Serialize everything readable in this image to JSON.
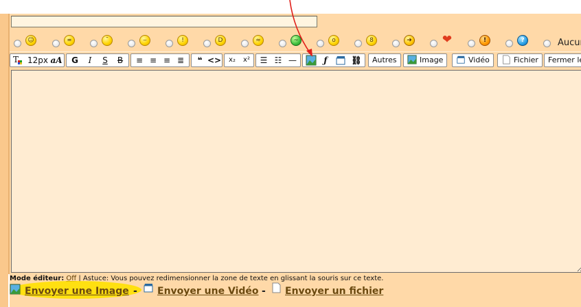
{
  "title_input": {
    "value": ""
  },
  "smileys": [
    {
      "icon": "happy-smiley-icon",
      "glyph": "☺"
    },
    {
      "icon": "smirk-smiley-icon",
      "glyph": "≖"
    },
    {
      "icon": "wink-smiley-icon",
      "glyph": "˘"
    },
    {
      "icon": "grin-smiley-icon",
      "glyph": "⌣"
    },
    {
      "icon": "surprised-smiley-icon",
      "glyph": "!"
    },
    {
      "icon": "big-grin-smiley-icon",
      "glyph": "D"
    },
    {
      "icon": "angry-smiley-icon",
      "glyph": "≈"
    },
    {
      "icon": "sick-smiley-icon",
      "glyph": "~"
    },
    {
      "icon": "shocked-smiley-icon",
      "glyph": "o"
    },
    {
      "icon": "cool-smiley-icon",
      "glyph": "8"
    },
    {
      "icon": "arrow-right-icon",
      "glyph": "➜"
    },
    {
      "icon": "heart-icon",
      "glyph": "❤"
    },
    {
      "icon": "warning-icon",
      "glyph": "!"
    },
    {
      "icon": "help-icon",
      "glyph": "?"
    }
  ],
  "smiley_none_label": "Aucun",
  "toolbar": {
    "font_size": "12px",
    "font_case": "aA",
    "bold": "G",
    "italic": "I",
    "underline": "S",
    "strike": "B",
    "quote": "❝",
    "code": "<>",
    "subscript": "x₂",
    "superscript": "x²",
    "other_label": "Autres",
    "image_label": "Image",
    "video_label": "Vidéo",
    "file_label": "Fichier",
    "close_label": "Fermer le"
  },
  "editor": {
    "value": ""
  },
  "hint": {
    "mode_label": "Mode éditeur:",
    "mode_value": "Off",
    "text": " | Astuce: Vous pouvez redimensionner la zone de texte en glissant la souris sur ce texte."
  },
  "links": {
    "image": "Envoyer une Image",
    "video": "Envoyer une Vidéo",
    "file": "Envoyer un fichier",
    "separator": "-"
  },
  "colors": {
    "panel": "#ffd9a8",
    "editor": "#ffecd2",
    "highlight": "#ffe000",
    "annotation": "#e0201a"
  }
}
